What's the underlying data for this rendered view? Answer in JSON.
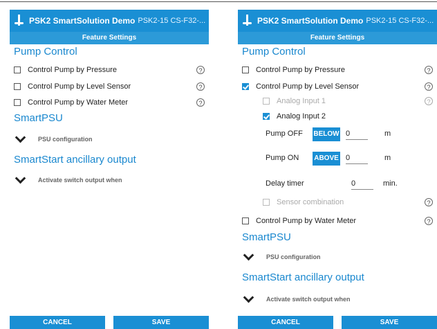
{
  "app": {
    "title": "PSK2 SmartSolution Demo",
    "device": "PSK2-15 CS-F32-...",
    "subtitle": "Feature Settings"
  },
  "pump_control": {
    "heading": "Pump Control",
    "pressure_label": "Control Pump by Pressure",
    "level_label": "Control Pump by Level Sensor",
    "meter_label": "Control Pump by Water Meter",
    "help_symbol": "?"
  },
  "level_settings": {
    "analog1_label": "Analog Input 1",
    "analog2_label": "Analog Input 2",
    "pump_off_label": "Pump OFF",
    "pump_off_mode": "BELOW",
    "pump_off_value": "0",
    "pump_off_unit": "m",
    "pump_on_label": "Pump ON",
    "pump_on_mode": "ABOVE",
    "pump_on_value": "0",
    "pump_on_unit": "m",
    "delay_label": "Delay timer",
    "delay_value": "0",
    "delay_unit": "min.",
    "combination_label": "Sensor combination"
  },
  "smartpsu": {
    "heading": "SmartPSU",
    "collapse_label": "PSU configuration"
  },
  "smartstart": {
    "heading": "SmartStart ancillary output",
    "collapse_label": "Activate switch output when"
  },
  "footer": {
    "cancel": "CANCEL",
    "save": "SAVE"
  },
  "colors": {
    "accent": "#1a8fd4",
    "section_text": "#1a88cf"
  }
}
